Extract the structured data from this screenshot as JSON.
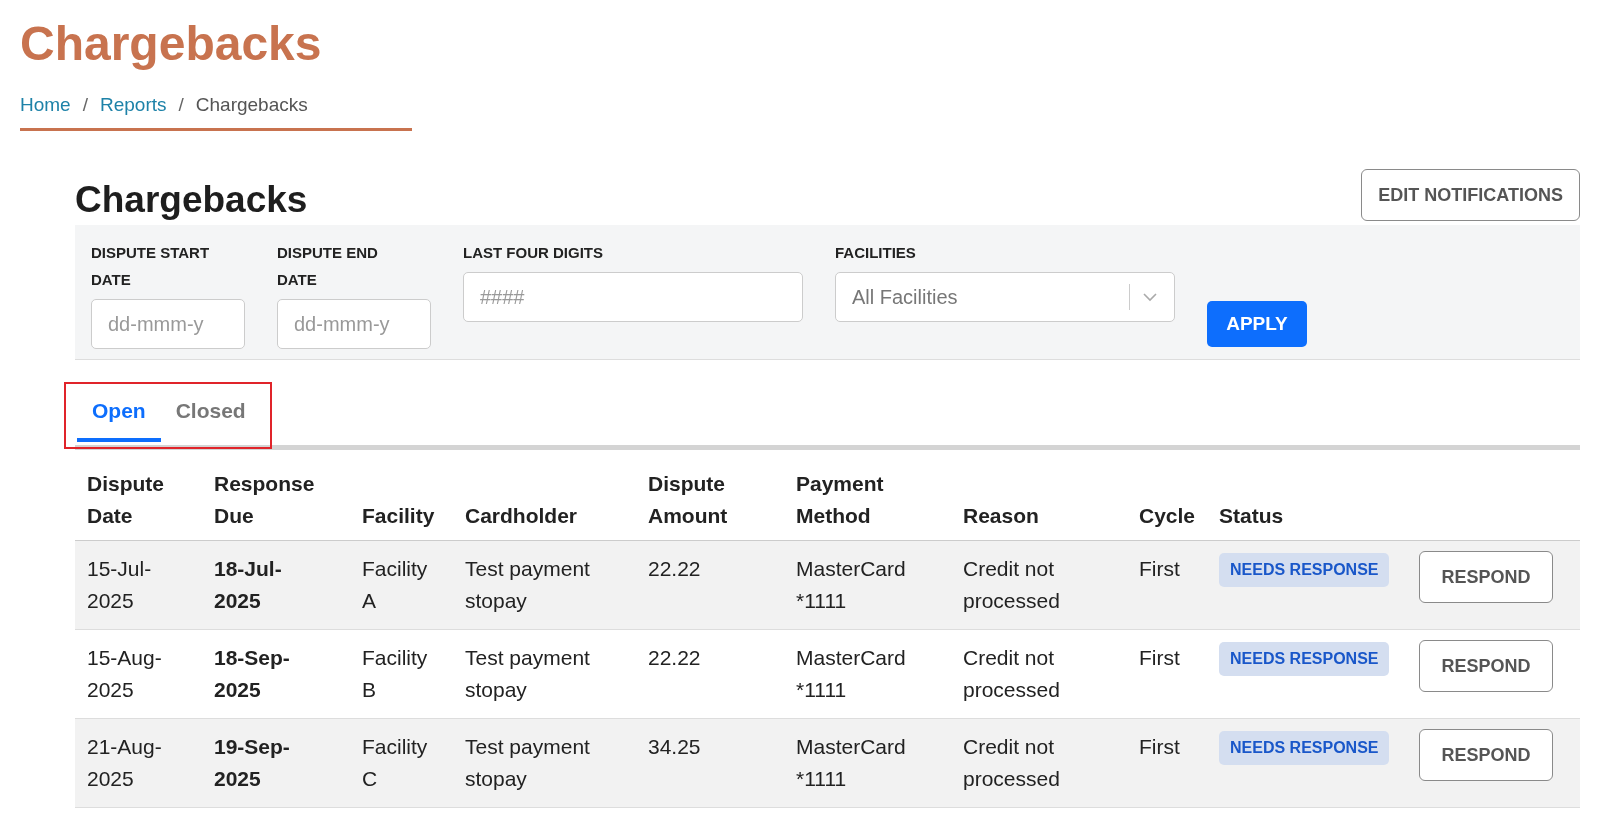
{
  "page_title": "Chargebacks",
  "breadcrumb_separator": "/",
  "breadcrumb": [
    {
      "label": "Home",
      "link": true
    },
    {
      "label": "Reports",
      "link": true
    },
    {
      "label": "Chargebacks",
      "link": false
    }
  ],
  "heading": "Chargebacks",
  "edit_button": "EDIT NOTIFICATIONS",
  "filters": [
    {
      "kind": "date",
      "label": "DISPUTE START DATE",
      "placeholder": "dd-mmm-y"
    },
    {
      "kind": "date",
      "label": "DISPUTE END DATE",
      "placeholder": "dd-mmm-y"
    },
    {
      "kind": "text",
      "label": "LAST FOUR DIGITS",
      "placeholder": "####"
    },
    {
      "kind": "select",
      "label": "FACILITIES",
      "value": "All Facilities"
    }
  ],
  "apply_button": "APPLY",
  "tabs": {
    "highlighted": true,
    "items": [
      {
        "label": "Open",
        "selected": true
      },
      {
        "label": "Closed",
        "selected": false
      }
    ]
  },
  "table": {
    "columns": [
      "Dispute Date",
      "Response Due",
      "Facility",
      "Cardholder",
      "Dispute Amount",
      "Payment Method",
      "Reason",
      "Cycle",
      "Status"
    ],
    "rows": [
      {
        "dispute_date": "15-Jul-2025",
        "response_due": "18-Jul-2025",
        "facility": "Facility A",
        "cardholder": "Test payment stopay",
        "amount": "22.22",
        "payment_method": "MasterCard *1111",
        "reason": "Credit not processed",
        "cycle": "First",
        "status": "NEEDS RESPONSE",
        "action": "RESPOND"
      },
      {
        "dispute_date": "15-Aug-2025",
        "response_due": "18-Sep-2025",
        "facility": "Facility B",
        "cardholder": "Test payment stopay",
        "amount": "22.22",
        "payment_method": "MasterCard *1111",
        "reason": "Credit not processed",
        "cycle": "First",
        "status": "NEEDS RESPONSE",
        "action": "RESPOND"
      },
      {
        "dispute_date": "21-Aug-2025",
        "response_due": "19-Sep-2025",
        "facility": "Facility C",
        "cardholder": "Test payment stopay",
        "amount": "34.25",
        "payment_method": "MasterCard *1111",
        "reason": "Credit not processed",
        "cycle": "First",
        "status": "NEEDS RESPONSE",
        "action": "RESPOND"
      }
    ]
  }
}
